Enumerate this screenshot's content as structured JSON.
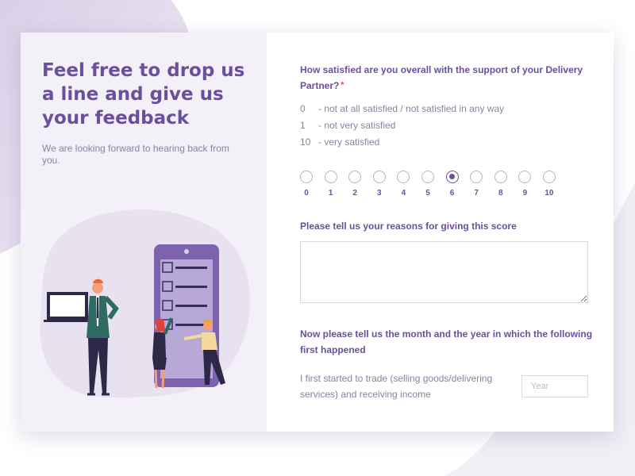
{
  "left_panel": {
    "headline": "Feel free to drop us a line and give us your feedback",
    "subline": "We are looking forward to hearing back from you."
  },
  "question1": {
    "title": "How satisfied are you overall with the support of your Delivery Partner?",
    "required_mark": "*",
    "scale_legend": [
      {
        "value": "0",
        "text": "- not at all satisfied / not satisfied in any way"
      },
      {
        "value": "1",
        "text": "- not very satisfied"
      },
      {
        "value": "10",
        "text": "- very satisfied"
      }
    ],
    "options": [
      "0",
      "1",
      "2",
      "3",
      "4",
      "5",
      "6",
      "7",
      "8",
      "9",
      "10"
    ],
    "selected": "6"
  },
  "question2": {
    "title": "Please tell us your reasons for giving this score",
    "value": ""
  },
  "question3": {
    "title": "Now please tell us the month and the year in which the following first happened",
    "label": "I first started to trade (selling goods/delivering services) and receiving income",
    "year_placeholder": "Year"
  },
  "colors": {
    "accent": "#6b4f9c",
    "muted_text": "#8a82a0",
    "panel_bg": "#f3f0f8",
    "required": "#e0433b"
  }
}
